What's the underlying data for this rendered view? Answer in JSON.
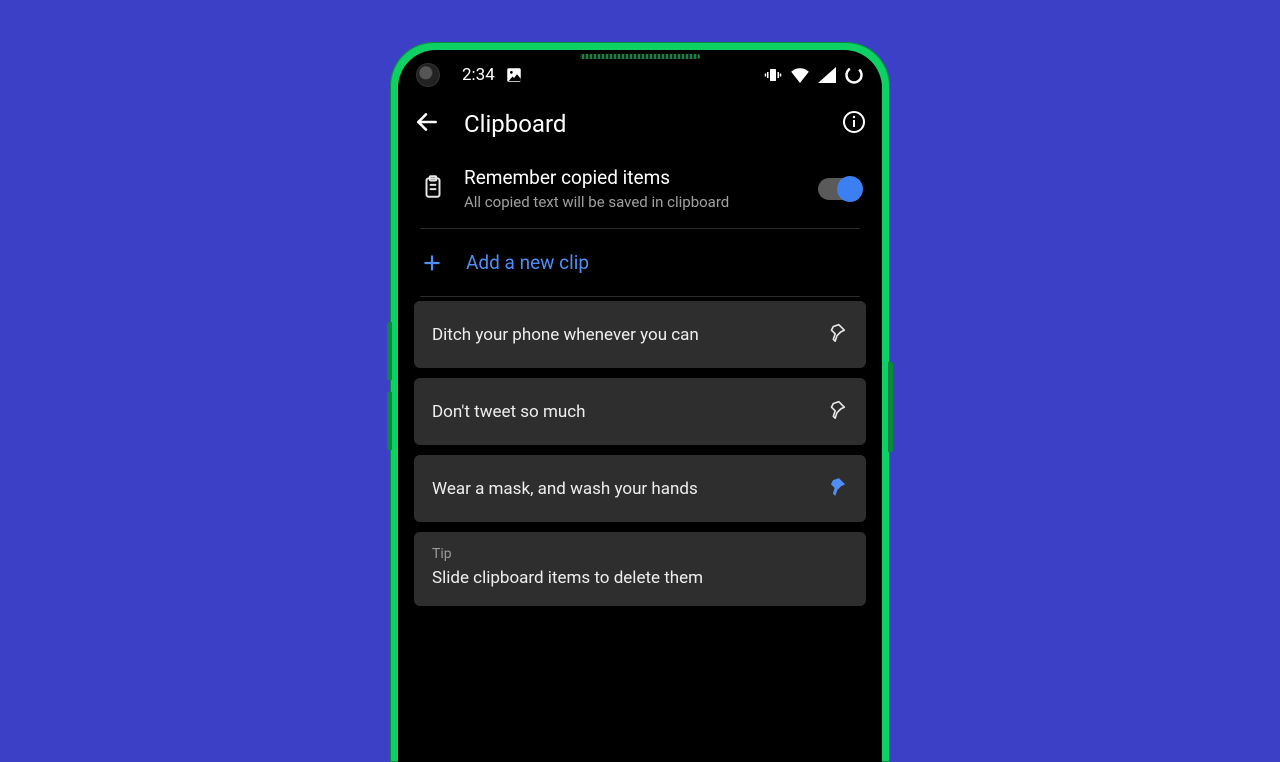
{
  "status": {
    "time": "2:34"
  },
  "appbar": {
    "title": "Clipboard"
  },
  "remember": {
    "title": "Remember copied items",
    "subtitle": "All copied text will be saved in clipboard",
    "enabled": true
  },
  "addClip": {
    "label": "Add a new clip"
  },
  "clips": [
    {
      "text": "Ditch your phone whenever you can",
      "pinned": false
    },
    {
      "text": "Don't tweet so much",
      "pinned": false
    },
    {
      "text": "Wear a mask, and wash your hands",
      "pinned": true
    }
  ],
  "tip": {
    "label": "Tip",
    "text": "Slide clipboard items to delete them"
  },
  "colors": {
    "accent": "#4f8ef5"
  }
}
